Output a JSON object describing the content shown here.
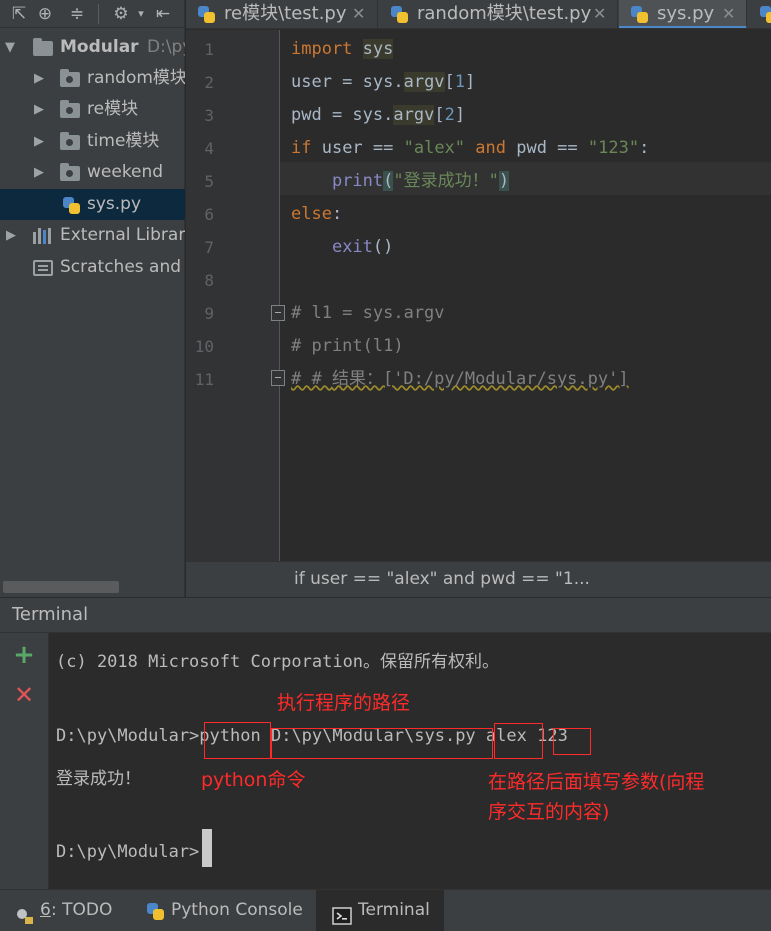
{
  "project": {
    "root_label": "Modular",
    "root_path": "D:\\py\\Modular",
    "items": [
      {
        "label": "random模块"
      },
      {
        "label": "re模块"
      },
      {
        "label": "time模块"
      },
      {
        "label": "weekend"
      },
      {
        "label": "sys.py"
      },
      {
        "label": "External Libraries"
      },
      {
        "label": "Scratches and Consoles"
      }
    ]
  },
  "tabs": [
    {
      "label": "re模块\\test.py"
    },
    {
      "label": "random模块\\test.py"
    },
    {
      "label": "sys.py"
    }
  ],
  "editor": {
    "line_numbers": [
      "1",
      "2",
      "3",
      "4",
      "5",
      "6",
      "7",
      "8",
      "9",
      "10",
      "11"
    ],
    "code": {
      "l1_kw": "import",
      "l1_mod": "sys",
      "l2_a": "user = sys.",
      "l2_b": "argv",
      "l2_c": "[",
      "l2_d": "1",
      "l2_e": "]",
      "l3_a": "pwd = sys.",
      "l3_b": "argv",
      "l3_c": "[",
      "l3_d": "2",
      "l3_e": "]",
      "l4_kw1": "if",
      "l4_a": " user == ",
      "l4_s1": "\"alex\"",
      "l4_kw2": " and",
      "l4_b": " pwd == ",
      "l4_s2": "\"123\"",
      "l4_c": ":",
      "l5_fn": "print",
      "l5_p1": "(",
      "l5_s": "\"登录成功！\"",
      "l5_p2": ")",
      "l6_kw": "else",
      "l6_c": ":",
      "l7_fn": "exit",
      "l7_p": "()",
      "l9": "# l1 = sys.argv",
      "l10": "# print(l1)",
      "l11_a": "# # ",
      "l11_b": "结果：['D:/py/Modular/sys.py']"
    },
    "breadcrumb": "if user == \"alex\" and pwd == \"1..."
  },
  "terminal": {
    "title": "Terminal",
    "copyright": "(c) 2018 Microsoft Corporation。保留所有权利。",
    "prompt": "D:\\py\\Modular>",
    "cmd_python": "python",
    "cmd_path": "D:\\py\\Modular\\sys.py",
    "cmd_arg1": "alex",
    "cmd_arg2": "123",
    "output": "登录成功！",
    "prompt2": "D:\\py\\Modular>",
    "notes": {
      "path": "执行程序的路径",
      "python": "python命令",
      "args_1": "在路径后面填写参数(向程",
      "args_2": "序交互的内容)"
    }
  },
  "bottom_bar": {
    "todo_num": "6",
    "todo_label": ": TODO",
    "python_console": "Python Console",
    "terminal": "Terminal"
  }
}
